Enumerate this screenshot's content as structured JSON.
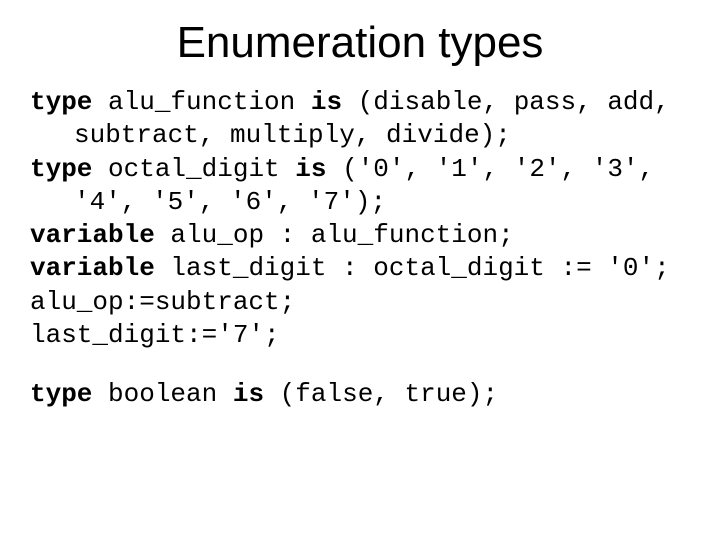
{
  "title": "Enumeration types",
  "l1_k1": "type",
  "l1_t1": " alu_function ",
  "l1_k2": "is",
  "l1_t2": " (disable, pass, add, subtract, multiply, divide);",
  "l2_k1": "type",
  "l2_t1": " octal_digit ",
  "l2_k2": "is",
  "l2_t2": " ('0', '1', '2', '3', '4', '5', '6', '7');",
  "l3_k1": "variable",
  "l3_t1": " alu_op : alu_function;",
  "l4_k1": "variable",
  "l4_t1": " last_digit : octal_digit := '0';",
  "l5": "alu_op:=subtract;",
  "l6": "last_digit:='7';",
  "l7_k1": "type",
  "l7_t1": " boolean ",
  "l7_k2": "is",
  "l7_t2": " (false, true);"
}
